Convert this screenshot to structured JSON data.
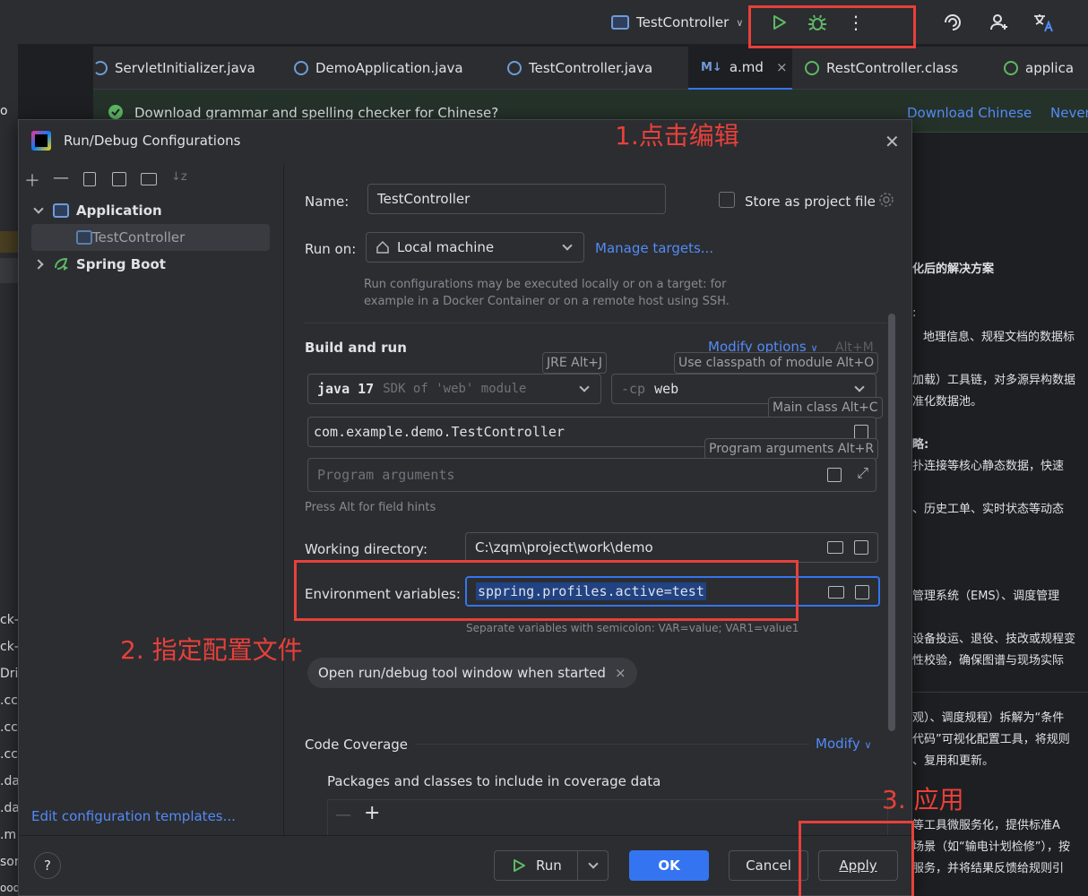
{
  "toolbar": {
    "run_config": "TestController",
    "run_icon": "run-icon",
    "debug_icon": "debug-icon",
    "more_icon": "more-icon"
  },
  "tabs": [
    {
      "label": "ServletInitializer.java"
    },
    {
      "label": "DemoApplication.java"
    },
    {
      "label": "TestController.java"
    },
    {
      "label": "a.md",
      "badge": "M↓"
    },
    {
      "label": "RestController.class"
    },
    {
      "label": "applica"
    }
  ],
  "banner": {
    "text": "Download grammar and spelling checker for Chinese?",
    "download_link": "Download Chinese",
    "never_link": "Never"
  },
  "left_strip": [
    "o",
    "ck-",
    "ck-",
    "Dri",
    ".cc",
    ".cc",
    ".cc",
    ".da",
    ".da",
    ".m",
    "son",
    "ooqle.android"
  ],
  "background_doc": [
    "化后的解决方案",
    ":",
    "地理信息、规程文档的数据标",
    "加载）工具链，对多源异构数据",
    "准化数据池。",
    "略:",
    "扑连接等核心静态数据，快速",
    "、历史工单、实时状态等动态",
    "管理系统（EMS）、调度管理",
    "设备投运、退役、技改或规程变",
    "性校验，确保图谱与现场实际",
    "观）、调度规程）拆解为“条件",
    "代码”可视化配置工具，将规则",
    "、复用和更新。",
    "等工具微服务化，提供标准A",
    "场景（如“输电计划检修”），按",
    "服务，并将结果反馈给规则引"
  ],
  "dialog": {
    "title": "Run/Debug Configurations",
    "tree": {
      "application": "Application",
      "test_controller": "TestController",
      "spring_boot": "Spring Boot"
    },
    "edit_templates": "Edit configuration templates...",
    "name_label": "Name:",
    "name_value": "TestController",
    "store_label": "Store as project file",
    "run_on_label": "Run on:",
    "run_on_value": "Local machine",
    "manage_targets": "Manage targets...",
    "run_on_hint_1": "Run configurations may be executed locally or on a target: for",
    "run_on_hint_2": "example in a Docker Container or on a remote host using SSH.",
    "build_and_run": "Build and run",
    "modify_options": "Modify options",
    "modify_shortcut": "Alt+M",
    "jre_tip": "JRE Alt+J",
    "classpath_tip": "Use classpath of module Alt+O",
    "sdk_java": "java 17",
    "sdk_desc": "SDK of 'web' module",
    "cp_flag": "-cp",
    "cp_value": "web",
    "main_class_tip": "Main class Alt+C",
    "main_class": "com.example.demo.TestController",
    "program_args_tip": "Program arguments Alt+R",
    "program_args_placeholder": "Program arguments",
    "press_alt_hint": "Press Alt for field hints",
    "working_dir_label": "Working directory:",
    "working_dir": "C:\\zqm\\project\\work\\demo",
    "env_label": "Environment variables:",
    "env_value": "sppring.profiles.active=test",
    "env_hint": "Separate variables with semicolon: VAR=value; VAR1=value1",
    "open_tool_window": "Open run/debug tool window when started",
    "code_coverage": "Code Coverage",
    "modify": "Modify",
    "packages_label": "Packages and classes to include in coverage data",
    "buttons": {
      "help": "?",
      "run": "Run",
      "ok": "OK",
      "cancel": "Cancel",
      "apply": "Apply"
    }
  },
  "annotations": {
    "step1": "1.点击编辑",
    "step2": "2. 指定配置文件",
    "step3": "3. 应用"
  },
  "colors": {
    "accent": "#3574f0",
    "annotation": "#e8403b",
    "run_green": "#5fb865"
  }
}
